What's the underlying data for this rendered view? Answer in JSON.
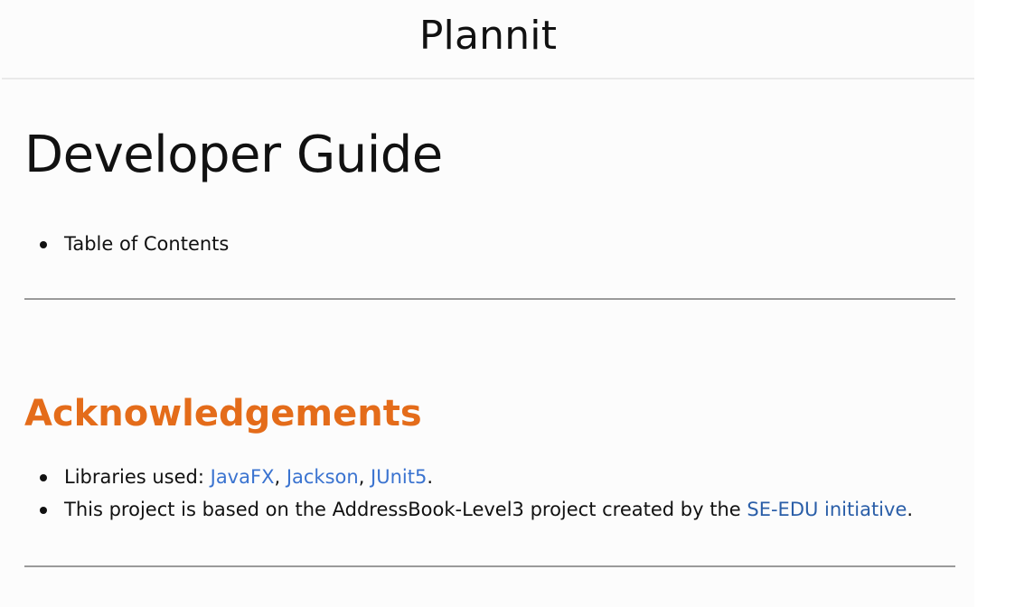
{
  "header": {
    "site_title": "Plannit"
  },
  "main": {
    "page_title": "Developer Guide",
    "toc": {
      "items": [
        {
          "label": "Table of Contents"
        }
      ]
    },
    "acknowledgements": {
      "heading": "Acknowledgements",
      "libraries_prefix": "Libraries used: ",
      "libraries": [
        {
          "label": "JavaFX"
        },
        {
          "label": "Jackson"
        },
        {
          "label": "JUnit5"
        }
      ],
      "sep": ", ",
      "end": ".",
      "based_on_prefix": "This project is based on the AddressBook-Level3 project created by the ",
      "based_on_link": "SE-EDU initiative",
      "based_on_suffix": "."
    }
  },
  "colors": {
    "heading_accent": "#e46c1a",
    "link": "#3a73d0"
  }
}
